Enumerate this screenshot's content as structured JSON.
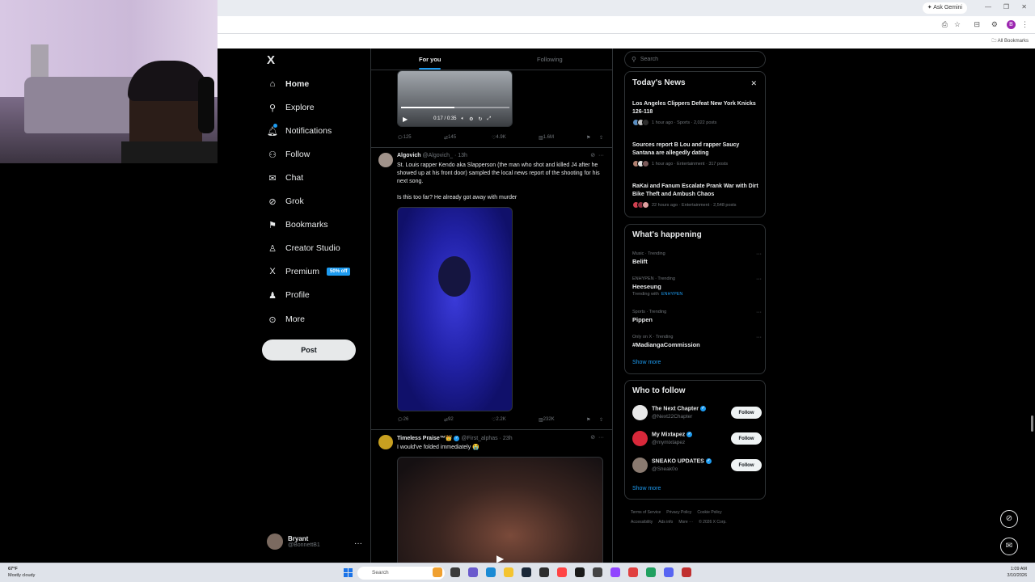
{
  "browser": {
    "ask_gemini": "Ask Gemini",
    "all_bookmarks": "All Bookmarks",
    "profile_initial": "B"
  },
  "nav": {
    "logo": "X",
    "items": [
      {
        "label": "Home",
        "icon": "home-icon",
        "glyph": "⌂"
      },
      {
        "label": "Explore",
        "icon": "search-icon",
        "glyph": "⚲"
      },
      {
        "label": "Notifications",
        "icon": "bell-icon",
        "glyph": "🔔︎"
      },
      {
        "label": "Follow",
        "icon": "person-add-icon",
        "glyph": "⚇"
      },
      {
        "label": "Chat",
        "icon": "mail-icon",
        "glyph": "✉"
      },
      {
        "label": "Grok",
        "icon": "grok-icon",
        "glyph": "⊘"
      },
      {
        "label": "Bookmarks",
        "icon": "bookmark-icon",
        "glyph": "⚑"
      },
      {
        "label": "Creator Studio",
        "icon": "creator-icon",
        "glyph": "♙"
      },
      {
        "label": "Premium",
        "icon": "x-icon",
        "glyph": "X"
      },
      {
        "label": "Profile",
        "icon": "profile-icon",
        "glyph": "♟"
      },
      {
        "label": "More",
        "icon": "more-circle-icon",
        "glyph": "⊙"
      }
    ],
    "premium_badge": "50% off",
    "post_button": "Post",
    "user": {
      "name": "Bryant",
      "handle": "@BonnettB1"
    }
  },
  "feed": {
    "tabs": [
      "For you",
      "Following"
    ],
    "video1": {
      "time": "0:17 / 0:35",
      "progress": 0.49
    },
    "tweet1_actions": {
      "replies": "125",
      "reposts": "145",
      "likes": "4.9K",
      "views": "1.6M"
    },
    "tweet2": {
      "name": "Algovich",
      "handle": "@Algovich_",
      "time": "13h",
      "text1": "St. Louis rapper Kendo aka Slapperson (the man who shot and killed J4 after he showed up at his front door) sampled the local news report of the shooting for his next song.",
      "text2": "Is this too far? He already got away with murder",
      "actions": {
        "replies": "26",
        "reposts": "92",
        "likes": "2.2K",
        "views": "232K"
      }
    },
    "tweet3": {
      "name": "Timeless Praise™👑",
      "handle": "@First_alphas",
      "time": "23h",
      "text": "I would've folded immediately 😭"
    }
  },
  "search": {
    "placeholder": "Search"
  },
  "todays_news": {
    "title": "Today's News",
    "items": [
      {
        "title": "Los Angeles Clippers Defeat New York Knicks 126-118",
        "meta": "1 hour ago · Sports · 2,022 posts"
      },
      {
        "title": "Sources report B Lou and rapper Saucy Santana are allegedly dating",
        "meta": "1 hour ago · Entertainment · 317 posts"
      },
      {
        "title": "RaKai and Fanum Escalate Prank War with Dirt Bike Theft and Ambush Chaos",
        "meta": "22 hours ago · Entertainment · 2,548 posts"
      }
    ]
  },
  "whats_happening": {
    "title": "What's happening",
    "trends": [
      {
        "category": "Music · Trending",
        "name": "Belift",
        "with": ""
      },
      {
        "category": "ENHYPEN · Trending",
        "name": "Heeseung",
        "with_prefix": "Trending with",
        "with": "ENHYPEN"
      },
      {
        "category": "Sports · Trending",
        "name": "Pippen",
        "with": ""
      },
      {
        "category": "Only on X · Trending",
        "name": "#MadiangaCommission",
        "with": ""
      }
    ],
    "show_more": "Show more"
  },
  "who_to_follow": {
    "title": "Who to follow",
    "accounts": [
      {
        "name": "The Next Chapter",
        "handle": "@Next22Chapter",
        "button": "Follow"
      },
      {
        "name": "My Mixtapez",
        "handle": "@mymixtapez",
        "button": "Follow"
      },
      {
        "name": "SNEAKO UPDATES",
        "handle": "@Sneak0o",
        "button": "Follow"
      }
    ],
    "show_more": "Show more"
  },
  "footer": {
    "links": [
      "Terms of Service",
      "Privacy Policy",
      "Cookie Policy",
      "Accessibility",
      "Ads info",
      "More ···",
      "© 2026 X Corp."
    ]
  },
  "taskbar": {
    "weather_temp": "67°F",
    "weather_desc": "Mostly cloudy",
    "search_label": "Search",
    "time": "1:09 AM",
    "date": "3/10/2026"
  },
  "colors": {
    "accent": "#1d9bf0",
    "background": "#000000",
    "border": "#2f3336",
    "muted": "#71767b"
  }
}
